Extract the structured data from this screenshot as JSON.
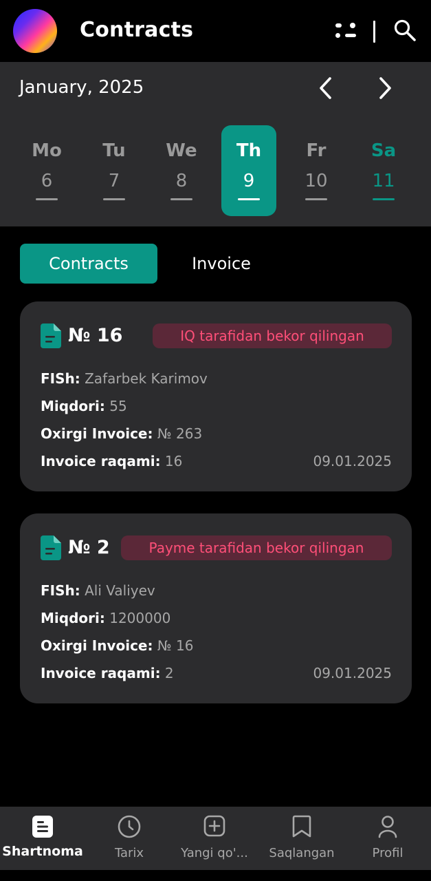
{
  "header": {
    "title": "Contracts",
    "avatar_icon": "user-avatar-gradient",
    "filter_icon": "filter-icon",
    "search_icon": "search-icon"
  },
  "calendar": {
    "month": "January, 2025",
    "prev_icon": "chevron-left-icon",
    "next_icon": "chevron-right-icon",
    "days": [
      {
        "name": "Mo",
        "date": "6"
      },
      {
        "name": "Tu",
        "date": "7"
      },
      {
        "name": "We",
        "date": "8"
      },
      {
        "name": "Th",
        "date": "9",
        "selected": true
      },
      {
        "name": "Fr",
        "date": "10"
      },
      {
        "name": "Sa",
        "date": "11",
        "weekend": true
      }
    ],
    "accent_color": "#0a9686"
  },
  "tabs": {
    "contracts": "Contracts",
    "invoice": "Invoice",
    "active": "contracts"
  },
  "cards": [
    {
      "number": "№ 16",
      "status": "IQ tarafidan bekor qilingan",
      "fish_label": "FISh:",
      "fish_value": "Zafarbek Karimov",
      "amount_label": "Miqdori:",
      "amount_value": "55",
      "last_invoice_label": "Oxirgi Invoice:",
      "last_invoice_value": "№ 263",
      "invoice_number_label": "Invoice raqami:",
      "invoice_number_value": "16",
      "date": "09.01.2025"
    },
    {
      "number": "№ 2",
      "status": "Payme tarafidan bekor qilingan",
      "fish_label": "FISh:",
      "fish_value": "Ali Valiyev",
      "amount_label": "Miqdori:",
      "amount_value": "1200000",
      "last_invoice_label": "Oxirgi Invoice:",
      "last_invoice_value": "№ 16",
      "invoice_number_label": "Invoice raqami:",
      "invoice_number_value": "2",
      "date": "09.01.2025"
    }
  ],
  "status_colors": {
    "badge_bg": "#5b2838",
    "badge_text": "#ff4f78"
  },
  "bottom_nav": [
    {
      "label": "Shartnoma",
      "icon": "document-icon",
      "active": true
    },
    {
      "label": "Tarix",
      "icon": "clock-icon"
    },
    {
      "label": "Yangi qo'...",
      "icon": "add-square-icon"
    },
    {
      "label": "Saqlangan",
      "icon": "bookmark-icon"
    },
    {
      "label": "Profil",
      "icon": "user-icon"
    }
  ]
}
